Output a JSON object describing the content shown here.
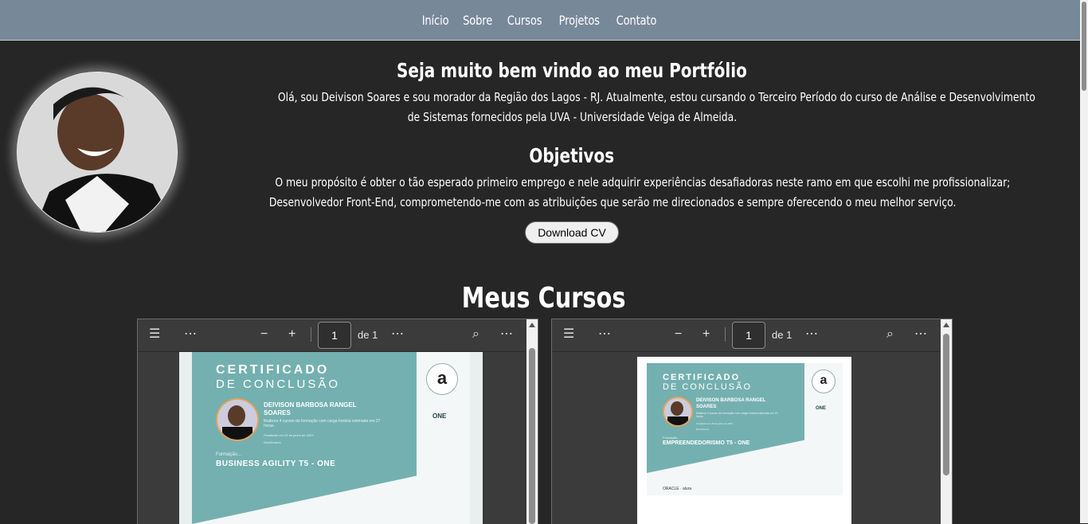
{
  "nav": {
    "items": [
      "Início",
      "Sobre",
      "Cursos",
      "Projetos",
      "Contato"
    ]
  },
  "intro": {
    "welcome_title": "Seja muito bem vindo ao meu Portfólio",
    "about_line1": "Olá, sou Deivison Soares e sou morador da Região dos Lagos - RJ. Atualmente, estou cursando o Terceiro Período do curso de Análise e Desenvolvimento",
    "about_line2": "de Sistemas fornecidos pela UVA - Universidade Veiga de Almeida.",
    "objectives_title": "Objetivos",
    "objectives_line1": "O meu propósito é obter o tão esperado primeiro emprego e nele adquirir experiências desafiadoras neste ramo em que escolhi me profissionalizar;",
    "objectives_line2": "Desenvolvedor Front-End, comprometendo-me com as atribuições que serão me direcionados e sempre oferecendo o meu melhor serviço.",
    "download_button": "Download CV"
  },
  "courses": {
    "title": "Meus Cursos",
    "viewers": [
      {
        "page": "1",
        "of_label": "de 1",
        "cert": {
          "title": "CERTIFICADO",
          "subtitle": "DE CONCLUSÃO",
          "name_line1": "DEIVISON BARBOSA RANGEL",
          "name_line2": "SOARES",
          "desc": "finalizou 4 cursos da formação com carga horária estimada em 27 horas.",
          "date": "Finalizado em 23 de junho de 2023",
          "handle": "DeiviSoares",
          "formation_label": "Formação...",
          "formation": "BUSINESS AGILITY T5 - ONE",
          "seal": "a",
          "one": "ONE"
        }
      },
      {
        "page": "1",
        "of_label": "de 1",
        "cert": {
          "title": "CERTIFICADO",
          "subtitle": "DE CONCLUSÃO",
          "name_line1": "DEIVISON BARBOSA RANGEL",
          "name_line2": "SOARES",
          "desc": "finalizou 4 cursos da formação com carga horária estimada em 20 horas.",
          "date": "Finalizado em 20 de julho de 2023",
          "handle": "DeiviSoares",
          "formation_label": "Formação...",
          "formation": "EMPREENDEDORISMO T5 - ONE",
          "seal": "a",
          "one": "ONE",
          "footer_logos": "ORACLE · alura"
        }
      }
    ]
  },
  "colors": {
    "nav_bg": "#778899",
    "page_bg": "#262626",
    "cert_teal": "#74b0b0"
  }
}
